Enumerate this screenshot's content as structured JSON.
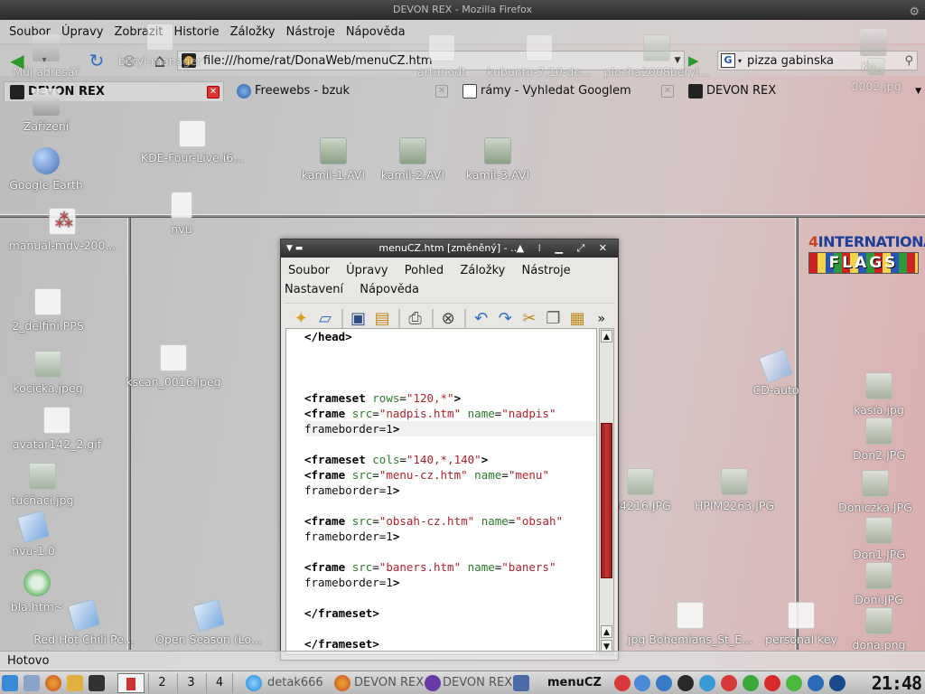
{
  "window": {
    "title": "DEVON REX - Mozilla Firefox"
  },
  "menubar": {
    "items": [
      "Soubor",
      "Úpravy",
      "Zobrazit",
      "Historie",
      "Záložky",
      "Nástroje",
      "Nápověda"
    ]
  },
  "navbar": {
    "url": "file:///home/rat/DonaWeb/menuCZ.htm",
    "search_value": "pizza gabinska",
    "search_engine": "G"
  },
  "tabs": [
    {
      "label": "DEVON REX",
      "active": true
    },
    {
      "label": "Freewebs - bzuk",
      "active": false
    },
    {
      "label": "rámy - Vyhledat Googlem",
      "active": false
    },
    {
      "label": "DEVON REX",
      "active": false
    }
  ],
  "desktop_icons": [
    {
      "label": "Můj adresář",
      "type": "dev"
    },
    {
      "label": "beryl-manager",
      "type": "doc"
    },
    {
      "label": "artur.odt",
      "type": "doc"
    },
    {
      "label": "kubuntu-7.10-de...",
      "type": "doc"
    },
    {
      "label": "plocha2008beryl...",
      "type": "pic"
    },
    {
      "label": "Ko...",
      "type": "dev"
    },
    {
      "label": "0002.jpg",
      "type": "pic"
    },
    {
      "label": "Zařízení",
      "type": "dev"
    },
    {
      "label": "KDE-Four-Live.i6...",
      "type": "doc"
    },
    {
      "label": "kamil-1.AVI",
      "type": "vid"
    },
    {
      "label": "kamil-2.AVI",
      "type": "vid"
    },
    {
      "label": "kamil-3.AVI",
      "type": "vid"
    },
    {
      "label": "Google Earth",
      "type": "globe"
    },
    {
      "label": "nvu",
      "type": "doc"
    },
    {
      "label": "manual-mdv-200...",
      "type": "pdf"
    },
    {
      "label": "2_delfini.PPS",
      "type": "doc"
    },
    {
      "label": "kscan_0016.jpeg",
      "type": "doc"
    },
    {
      "label": "kocicka.jpeg",
      "type": "pic"
    },
    {
      "label": "avatar142_2.gif",
      "type": "doc"
    },
    {
      "label": "tučňaci.jpg",
      "type": "pic"
    },
    {
      "label": "nvu-1.0",
      "type": "blue"
    },
    {
      "label": "bla.htm~",
      "type": "green"
    },
    {
      "label": "Red Hot Chili Pe...",
      "type": "blue"
    },
    {
      "label": "Open Season (Lo...",
      "type": "blue"
    },
    {
      "label": "CD-auto",
      "type": "cd"
    },
    {
      "label": "kasia.jpg",
      "type": "pic"
    },
    {
      "label": "Don2.JPG",
      "type": "pic"
    },
    {
      "label": "Doniczka.JPG",
      "type": "pic"
    },
    {
      "label": "Don1.JPG",
      "type": "pic"
    },
    {
      "label": "Doni.JPG",
      "type": "pic"
    },
    {
      "label": "dona.png",
      "type": "pic"
    },
    {
      "label": "M4216.JPG",
      "type": "pic"
    },
    {
      "label": "HPIM2263.JPG",
      "type": "pic"
    },
    {
      "label": "jpg Bohemians_St_E...",
      "type": "doc"
    },
    {
      "label": "personal key",
      "type": "doc"
    }
  ],
  "flags_logo": {
    "line1_a": "4",
    "line1_b": "INTERNATIONAL",
    "line2": "FLAGS"
  },
  "editor": {
    "title": "menuCZ.htm [změněný] - ...",
    "menu_row1": [
      "Soubor",
      "Úpravy",
      "Pohled",
      "Záložky",
      "Nástroje"
    ],
    "menu_row2": [
      "Nastavení",
      "Nápověda"
    ],
    "more_label": "»",
    "code_lines": [
      "</head>",
      "",
      "",
      "",
      "<frameset rows=\"120,*\">",
      "<frame src=\"nadpis.htm\" name=\"nadpis\"",
      "frameborder=1>",
      "",
      "<frameset cols=\"140,*,140\">",
      "<frame src=\"menu-cz.htm\" name=\"menu\"",
      "frameborder=1>",
      "",
      "<frame src=\"obsah-cz.htm\" name=\"obsah\"",
      "frameborder=1>",
      "",
      "<frame src=\"baners.htm\" name=\"baners\"",
      "frameborder=1>",
      "",
      "</frameset>",
      "",
      "</frameset>"
    ],
    "current_line": 6
  },
  "statusbar": {
    "text": "Hotovo"
  },
  "taskbar": {
    "desktops": [
      "2",
      "3",
      "4"
    ],
    "tasks": [
      "detak666",
      "DEVON REX",
      "DEVON REX",
      "menuCZ"
    ],
    "clock": "21:48"
  },
  "colors": {
    "accent_scroll": "#c23a3a",
    "tab_close_active": "#d33333"
  }
}
